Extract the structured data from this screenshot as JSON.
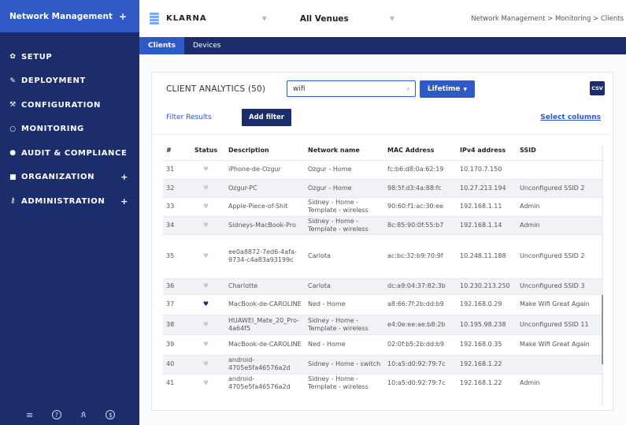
{
  "sidebar": {
    "title": "Network Management",
    "title_action": "+",
    "items": [
      {
        "label": "SETUP",
        "icon": "gear-icon",
        "glyph": "✿",
        "expand": ""
      },
      {
        "label": "DEPLOYMENT",
        "icon": "pencil-icon",
        "glyph": "✎",
        "expand": ""
      },
      {
        "label": "CONFIGURATION",
        "icon": "wrench-icon",
        "glyph": "⚒",
        "expand": ""
      },
      {
        "label": "MONITORING",
        "icon": "circle-icon",
        "glyph": "○",
        "expand": ""
      },
      {
        "label": "AUDIT & COMPLIANCE",
        "icon": "check-circle-icon",
        "glyph": "●",
        "expand": ""
      },
      {
        "label": "ORGANIZATION",
        "icon": "building-icon",
        "glyph": "■",
        "expand": "+"
      },
      {
        "label": "ADMINISTRATION",
        "icon": "key-icon",
        "glyph": "⚷",
        "expand": "+"
      }
    ],
    "footer_icons": [
      {
        "name": "menu-icon",
        "glyph": "≡"
      },
      {
        "name": "help-icon",
        "glyph": "?"
      },
      {
        "name": "user-icon",
        "glyph": "ጰ"
      },
      {
        "name": "billing-icon",
        "glyph": "$"
      }
    ]
  },
  "topbar": {
    "brand": "KLARNA",
    "venue": "All Venues",
    "breadcrumb": "Network Management > Monitoring > Clients"
  },
  "tabs": [
    {
      "label": "Clients",
      "active": true
    },
    {
      "label": "Devices",
      "active": false
    }
  ],
  "card": {
    "title": "CLIENT ANALYTICS (50)",
    "search_value": "wifi",
    "lifetime_label": "Lifetime",
    "csv_label": "CSV",
    "filter_label": "Filter Results",
    "add_filter_label": "Add filter",
    "select_columns_label": "Select columns"
  },
  "table": {
    "columns": [
      "#",
      "Status",
      "Description",
      "Network name",
      "MAC Address",
      "IPv4 address",
      "SSID"
    ],
    "rows": [
      {
        "num": "31",
        "fav": false,
        "desc": "iPhone-de-Ozgur",
        "net": "Ozgur - Home",
        "mac": "fc:b6:d8:0a:62:19",
        "ip": "10.170.7.150",
        "ssid": ""
      },
      {
        "num": "32",
        "fav": false,
        "desc": "Ozgur-PC",
        "net": "Ozgur - Home",
        "mac": "98:5f:d3:4a:88:fc",
        "ip": "10.27.213.194",
        "ssid": "Unconfigured SSID 2"
      },
      {
        "num": "33",
        "fav": false,
        "desc": "Apple-Piece-of-Shit",
        "net": "Sidney - Home - Template - wireless",
        "mac": "90:60:f1:ac:30:ee",
        "ip": "192.168.1.11",
        "ssid": "Admin"
      },
      {
        "num": "34",
        "fav": false,
        "desc": "Sidneys-MacBook-Pro",
        "net": "Sidney - Home - Template - wireless",
        "mac": "8c:85:90:0f:55:b7",
        "ip": "192.168.1.14",
        "ssid": "Admin"
      },
      {
        "num": "35",
        "fav": false,
        "desc": "ee0a8872-7ed6-4afa-9734-c4a83a93199c",
        "net": "Carlota",
        "mac": "ac:bc:32:b9:70:9f",
        "ip": "10.248.11.188",
        "ssid": "Unconfigured SSID 2"
      },
      {
        "num": "36",
        "fav": false,
        "desc": "Charlotte",
        "net": "Carlota",
        "mac": "dc:a9:04:37:82:3b",
        "ip": "10.230.213.250",
        "ssid": "Unconfigured SSID 3"
      },
      {
        "num": "37",
        "fav": true,
        "desc": "MacBook-de-CAROLINE",
        "net": "Ned - Home",
        "mac": "a8:66:7f:2b:dd:b9",
        "ip": "192.168.0.29",
        "ssid": "Make Wifi Great Again"
      },
      {
        "num": "38",
        "fav": false,
        "desc": "HUAWEI_Mate_20_Pro-4a64f5",
        "net": "Sidney - Home - Template - wireless",
        "mac": "e4:0e:ee:ae:b8:2b",
        "ip": "10.195.98.238",
        "ssid": "Unconfigured SSID 11"
      },
      {
        "num": "39",
        "fav": false,
        "desc": "MacBook-de-CAROLINE",
        "net": "Ned - Home",
        "mac": "02:0f:b5:2b:dd:b9",
        "ip": "192.168.0.35",
        "ssid": "Make Wifi Great Again"
      },
      {
        "num": "40",
        "fav": false,
        "desc": "android-4705e5fa46576a2d",
        "net": "Sidney - Home - switch",
        "mac": "10:a5:d0:92:79:7c",
        "ip": "192.168.1.22",
        "ssid": ""
      },
      {
        "num": "41",
        "fav": false,
        "desc": "android-4705e5fa46576a2d",
        "net": "Sidney - Home - Template - wireless",
        "mac": "10:a5:d0:92:79:7c",
        "ip": "192.168.1.22",
        "ssid": "Admin"
      }
    ]
  },
  "colors": {
    "sidebar_bg": "#1c2d6b",
    "accent": "#2f59c4",
    "favorite_on": "#1c2d6b"
  }
}
